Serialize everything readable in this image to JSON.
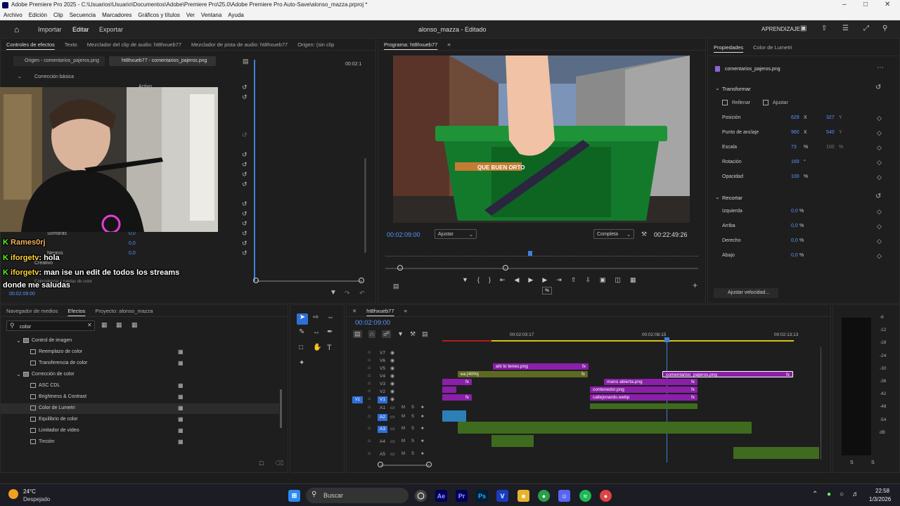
{
  "window": {
    "title": "Adobe Premiere Pro 2025 - C:\\Usuarios\\Usuario\\Documentos\\Adobe\\Premiere Pro\\25.0\\Adobe Premiere Pro Auto-Save\\alonso_mazza.prproj *"
  },
  "menu": [
    "Archivo",
    "Edición",
    "Clip",
    "Secuencia",
    "Marcadores",
    "Gráficos y títulos",
    "Ver",
    "Ventana",
    "Ayuda"
  ],
  "appbar": {
    "import": "Importar",
    "edit": "Editar",
    "export": "Exportar",
    "project": "alonso_mazza - Editado",
    "learn": "APRENDIZAJE"
  },
  "effect_controls": {
    "tabs": [
      "Controles de efectos",
      "Texto",
      "Mezclador del clip de audio: ht8hxueb77",
      "Mezclador de pista de audio: ht8hxueb77",
      "Origen: (sin clip"
    ],
    "source_tab": "Origen - comentarios_pajeros.png",
    "seq_tab": "ht8hxueb77 - comentarios_pajeros.png",
    "time_right": "00:02:1",
    "basic": "Corrección básica",
    "active": "Activo",
    "shadows": "Sombras",
    "shadows_val": "0,0",
    "blacks": "Negros",
    "blacks_val": "0,0",
    "mid_val": "0,0",
    "creative": "Creativo",
    "curves": "Coincidencia y ruedas de color",
    "timecode": "00:02:09:00"
  },
  "chat": [
    {
      "user": "Rames0rj",
      "msg": ""
    },
    {
      "user": "iforgetv",
      "msg": ": hola"
    },
    {
      "user": "iforgetv",
      "msg": ": man ise un edit de todos los streams"
    },
    {
      "user": "",
      "msg": "donde me saludas"
    }
  ],
  "program": {
    "title": "Programa: ht8hxueb77",
    "time": "00:02:09:00",
    "fit": "Ajustar",
    "quality": "Completa",
    "duration": "00:22:49:26",
    "stick_text": "QUE BUEN ORTO"
  },
  "properties": {
    "tabs": [
      "Propiedades",
      "Color de Lumetri"
    ],
    "clip": "comentarios_pajeros.png",
    "transform": "Transformar",
    "fill": "Rellenar",
    "fit": "Ajustar",
    "rows": [
      {
        "label": "Posición",
        "v1": "629",
        "u1": "X",
        "v2": "327",
        "u2": "Y"
      },
      {
        "label": "Punto de anclaje",
        "v1": "960",
        "u1": "X",
        "v2": "540",
        "u2": "Y"
      },
      {
        "label": "Escala",
        "v1": "73",
        "u1": "%",
        "v2": "100",
        "u2": "%"
      },
      {
        "label": "Rotación",
        "v1": "169",
        "u1": "°",
        "v2": "",
        "u2": ""
      },
      {
        "label": "Opacidad",
        "v1": "100",
        "u1": "%",
        "v2": "",
        "u2": ""
      }
    ],
    "crop": "Recortar",
    "crop_rows": [
      {
        "label": "Izquierda",
        "v": "0,0",
        "u": "%"
      },
      {
        "label": "Arriba",
        "v": "0,0",
        "u": "%"
      },
      {
        "label": "Derecho",
        "v": "0,0",
        "u": "%"
      },
      {
        "label": "Abajo",
        "v": "0,0",
        "u": "%"
      }
    ],
    "speed": "Ajustar velocidad..."
  },
  "effects": {
    "tabs": [
      "Navegador de medios",
      "Efectos",
      "Proyecto: alonso_mazza"
    ],
    "search": "color",
    "items": [
      {
        "label": "Control de imagen",
        "folder": true,
        "indent": 0
      },
      {
        "label": "Reemplazo de color",
        "folder": false,
        "indent": 1
      },
      {
        "label": "Transferencia de color",
        "folder": false,
        "indent": 1
      },
      {
        "label": "Corrección de color",
        "folder": true,
        "indent": 0
      },
      {
        "label": "ASC CDL",
        "folder": false,
        "indent": 1
      },
      {
        "label": "Brightness & Contrast",
        "folder": false,
        "indent": 1
      },
      {
        "label": "Color de Lumetri",
        "folder": false,
        "indent": 1
      },
      {
        "label": "Equilibrio de color",
        "folder": false,
        "indent": 1
      },
      {
        "label": "Limitador de vídeo",
        "folder": false,
        "indent": 1
      },
      {
        "label": "Tinción",
        "folder": false,
        "indent": 1
      }
    ]
  },
  "timeline": {
    "seq": "ht8hxueb77",
    "time": "00:02:09:00",
    "ruler": [
      "00:02:03:17",
      "00:02:08:15",
      "00:02:13:13"
    ],
    "tracks": [
      "V7",
      "V6",
      "V5",
      "V4",
      "V3",
      "V2",
      "V1",
      "A1",
      "A2",
      "A3",
      "A4",
      "A5"
    ],
    "clips": {
      "c1": "ahi lo tenes.png",
      "c2": "ea [40%]",
      "c3": "comentarios_pajeros.png",
      "c4": "mano abierta.png",
      "c5": "contenedor.png",
      "c6": "callejonardo.webp",
      "fx": "fx"
    }
  },
  "meter": {
    "scale": [
      "-6",
      "-12",
      "-18",
      "-24",
      "-30",
      "-36",
      "-42",
      "-48",
      "-54",
      "dB"
    ],
    "s": "S"
  },
  "taskbar": {
    "temp": "24°C",
    "weather": "Despejado",
    "search": "Buscar",
    "time": "22:58",
    "date": "1/3/2026"
  }
}
